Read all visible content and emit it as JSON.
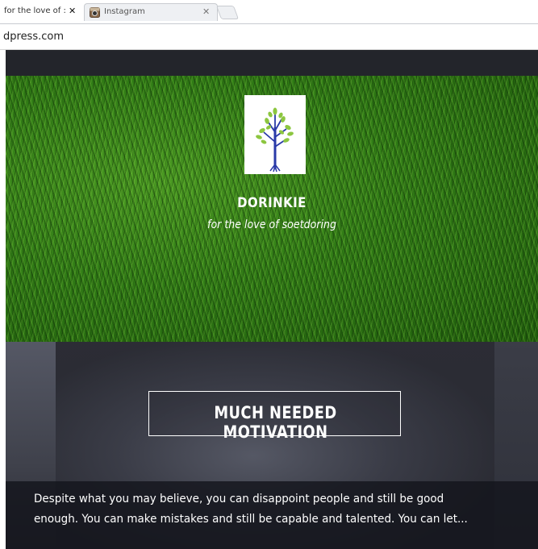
{
  "browser": {
    "tabs": [
      {
        "title": "for the love of :",
        "active": true
      },
      {
        "title": "Instagram",
        "active": false
      }
    ],
    "tab_close_glyph": "✕",
    "address": "dpress.com"
  },
  "site": {
    "title": "DORINKIE",
    "tagline": "for the love of soetdoring",
    "logo_icon": "tree-logo-icon"
  },
  "post": {
    "title": "MUCH NEEDED MOTIVATION",
    "excerpt": "Despite what you may believe, you can disappoint people and still be good enough. You can make mistakes and still be capable and talented. You can let..."
  },
  "colors": {
    "topbar": "#23252b",
    "grass": "#2f7a15",
    "logo_trunk": "#2a3aa8",
    "logo_leaves": "#8cc63f"
  }
}
